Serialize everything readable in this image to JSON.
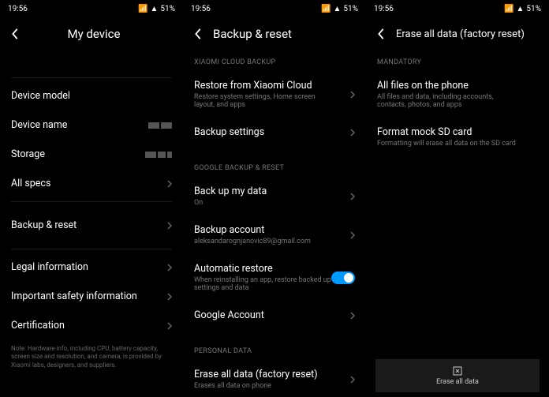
{
  "statusbar": {
    "time": "19:56",
    "battery": "51%"
  },
  "s1": {
    "title": "My device",
    "rows": {
      "model": "Device model",
      "name": "Device name",
      "storage": "Storage",
      "specs": "All specs",
      "backup": "Backup & reset",
      "legal": "Legal information",
      "safety": "Important safety information",
      "cert": "Certification"
    },
    "footnote": "Note: Hardware info, including CPU, battery capacity, screen size and resolution, and camera, is provided by Xiaomi labs, designers, and suppliers."
  },
  "s2": {
    "title": "Backup & reset",
    "sec1": "XIAOMI CLOUD BACKUP",
    "restore_title": "Restore from Xiaomi Cloud",
    "restore_sub": "Restore system settings, Home screen layout, and apps",
    "backup_settings": "Backup settings",
    "sec2": "GOOGLE BACKUP & RESET",
    "backup_data_title": "Back up my data",
    "backup_data_sub": "On",
    "account_title": "Backup account",
    "account_sub": "aleksandarognjanovic89@gmail.com",
    "auto_title": "Automatic restore",
    "auto_sub": "When reinstalling an app, restore backed up settings and data",
    "google_account": "Google Account",
    "sec3": "PERSONAL DATA",
    "erase_title": "Erase all data (factory reset)",
    "erase_sub": "Erases all data on phone"
  },
  "s3": {
    "title": "Erase all data (factory reset)",
    "sec": "MANDATORY",
    "files_title": "All files on the phone",
    "files_sub": "All files and data, including accounts, contacts, photos, and apps",
    "sd_title": "Format mock SD card",
    "sd_sub": "Formatting will erase all data on the SD card",
    "button": "Erase all data"
  }
}
